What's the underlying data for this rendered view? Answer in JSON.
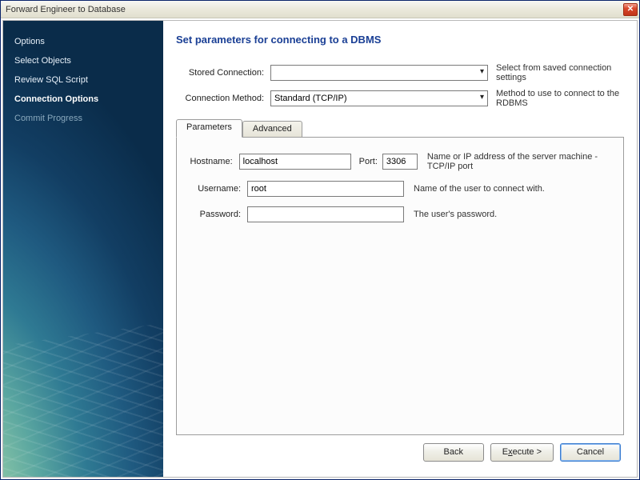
{
  "window": {
    "title": "Forward Engineer to Database"
  },
  "sidebar": {
    "items": [
      {
        "label": "Options",
        "state": "normal"
      },
      {
        "label": "Select Objects",
        "state": "normal"
      },
      {
        "label": "Review SQL Script",
        "state": "normal"
      },
      {
        "label": "Connection Options",
        "state": "active"
      },
      {
        "label": "Commit Progress",
        "state": "disabled"
      }
    ]
  },
  "main": {
    "title": "Set parameters for connecting to a DBMS",
    "stored_connection": {
      "label": "Stored Connection:",
      "value": "",
      "hint": "Select from saved connection settings"
    },
    "connection_method": {
      "label": "Connection Method:",
      "value": "Standard (TCP/IP)",
      "hint": "Method to use to connect to the RDBMS"
    },
    "tabs": {
      "parameters": "Parameters",
      "advanced": "Advanced"
    },
    "params": {
      "hostname_label": "Hostname:",
      "hostname_value": "localhost",
      "port_label": "Port:",
      "port_value": "3306",
      "host_hint": "Name or IP address of the server machine - TCP/IP port",
      "username_label": "Username:",
      "username_value": "root",
      "username_hint": "Name of the user to connect with.",
      "password_label": "Password:",
      "password_value": "",
      "password_hint": "The user's password."
    }
  },
  "buttons": {
    "back": "Back",
    "execute_prefix": "E",
    "execute_accel": "x",
    "execute_suffix": "ecute >",
    "cancel": "Cancel"
  }
}
